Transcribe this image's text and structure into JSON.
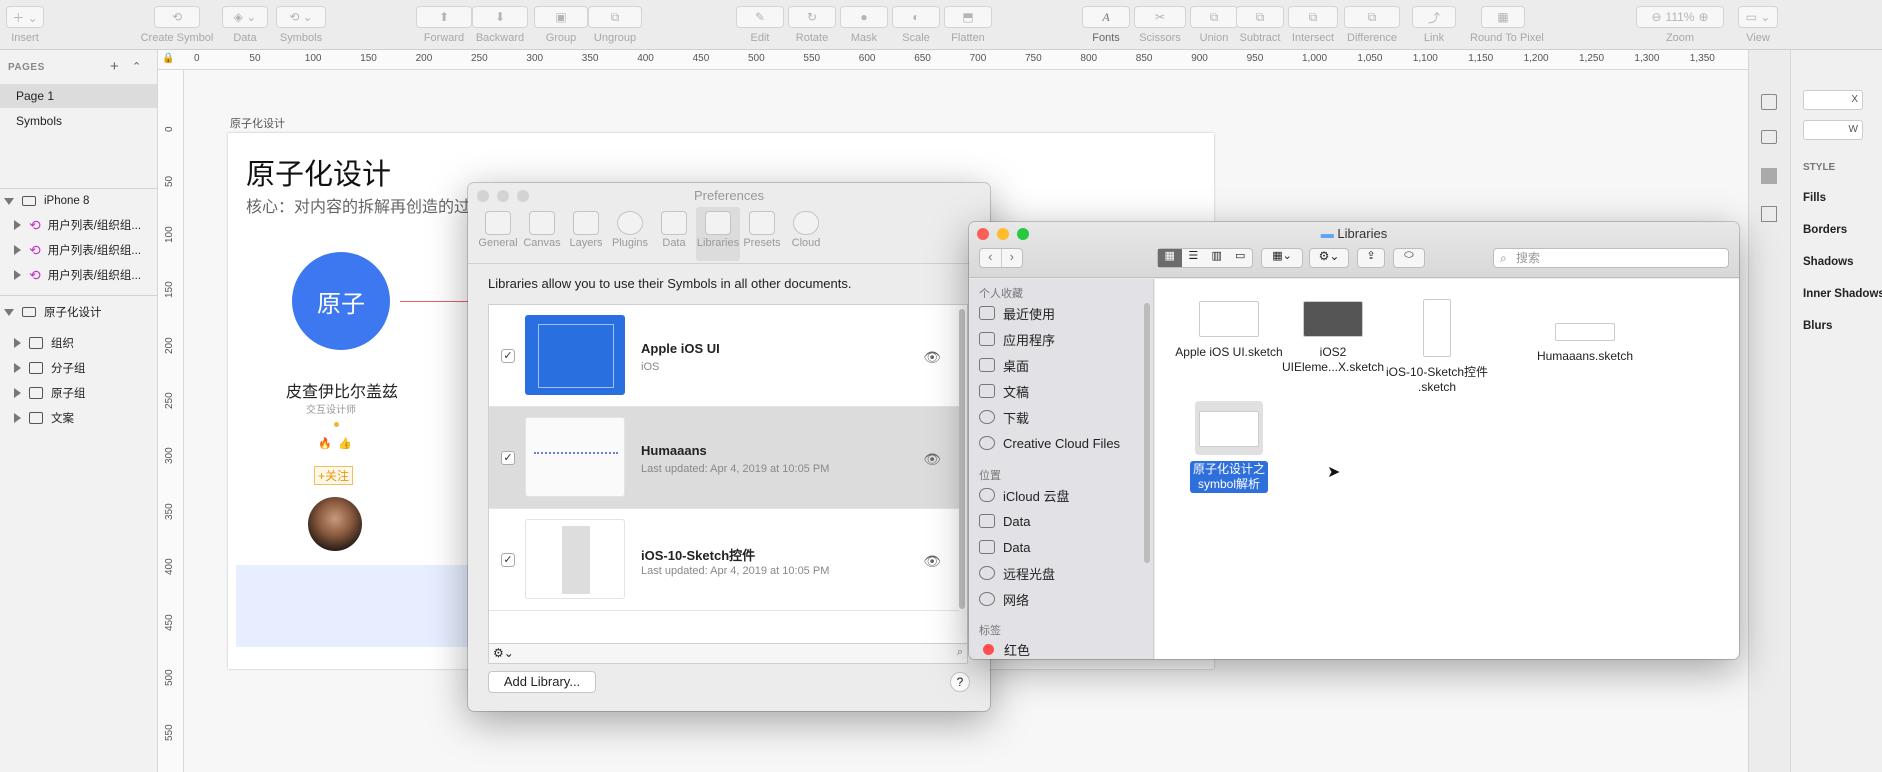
{
  "toolbar": {
    "insert": "Insert",
    "create_symbol": "Create Symbol",
    "data": "Data",
    "symbols": "Symbols",
    "forward": "Forward",
    "backward": "Backward",
    "group": "Group",
    "ungroup": "Ungroup",
    "edit": "Edit",
    "rotate": "Rotate",
    "mask": "Mask",
    "scale": "Scale",
    "flatten": "Flatten",
    "fonts": "Fonts",
    "scissors": "Scissors",
    "union": "Union",
    "subtract": "Subtract",
    "intersect": "Intersect",
    "difference": "Difference",
    "link": "Link",
    "round_to_pixel": "Round To Pixel",
    "zoom": "Zoom",
    "zoom_value": "111%",
    "view": "View"
  },
  "pages": {
    "header": "PAGES",
    "items": [
      "Page 1",
      "Symbols"
    ]
  },
  "layers": {
    "artboard1": "iPhone 8",
    "sym1": "用户列表/组织组...",
    "sym2": "用户列表/组织组...",
    "sym3": "用户列表/组织组...",
    "artboard2": "原子化设计",
    "g1": "组织",
    "g2": "分子组",
    "g3": "原子组",
    "g4": "文案"
  },
  "ruler": {
    "top": [
      "0",
      "50",
      "100",
      "150",
      "200",
      "250",
      "300",
      "350",
      "400",
      "450",
      "500",
      "550",
      "600",
      "650",
      "700",
      "750",
      "800",
      "850",
      "900",
      "950",
      "1,000",
      "1,050",
      "1,100",
      "1,150",
      "1,200",
      "1,250",
      "1,300",
      "1,350"
    ],
    "left": [
      "0",
      "50",
      "100",
      "150",
      "200",
      "250",
      "300",
      "350",
      "400",
      "450",
      "500",
      "550"
    ]
  },
  "artboard": {
    "label": "原子化设计",
    "title": "原子化设计",
    "subtitle": "核心：对内容的拆解再创造的过",
    "circle_text": "原子",
    "person_name": "皮查伊比尔盖兹",
    "person_role": "交互设计师",
    "follow": "+关注"
  },
  "preferences": {
    "title": "Preferences",
    "tabs": [
      "General",
      "Canvas",
      "Layers",
      "Plugins",
      "Data",
      "Libraries",
      "Presets",
      "Cloud"
    ],
    "description": "Libraries allow you to use their Symbols in all other documents.",
    "libraries": [
      {
        "name": "Apple iOS UI",
        "sub": "iOS"
      },
      {
        "name": "Humaaans",
        "sub": "Last updated: Apr 4, 2019 at 10:05 PM"
      },
      {
        "name": "iOS-10-Sketch控件",
        "sub": "Last updated: Apr 4, 2019 at 10:05 PM"
      }
    ],
    "add_library": "Add Library...",
    "help": "?"
  },
  "finder": {
    "title": "Libraries",
    "search_placeholder": "搜索",
    "favorites_header": "个人收藏",
    "favorites": [
      "最近使用",
      "应用程序",
      "桌面",
      "文稿",
      "下载",
      "Creative Cloud Files"
    ],
    "locations_header": "位置",
    "locations": [
      "iCloud 云盘",
      "Data",
      "Data",
      "远程光盘",
      "网络"
    ],
    "tags_header": "标签",
    "tags": [
      "红色"
    ],
    "files": [
      {
        "name": "Apple iOS UI.sketch"
      },
      {
        "name": "iOS2 UIEleme...X.sketch"
      },
      {
        "name": "iOS-10-Sketch控件 .sketch"
      },
      {
        "name": "Humaaans.sketch"
      },
      {
        "name": "原子化设计之symbol解析"
      }
    ]
  },
  "inspector": {
    "x_label": "X",
    "w_label": "W",
    "style": "STYLE",
    "fills": "Fills",
    "borders": "Borders",
    "shadows": "Shadows",
    "inner_shadows": "Inner Shadows",
    "blurs": "Blurs"
  },
  "colors": {
    "accent": "#3478f6",
    "circle": "#3d78f0",
    "selection": "#2f6fdc"
  }
}
